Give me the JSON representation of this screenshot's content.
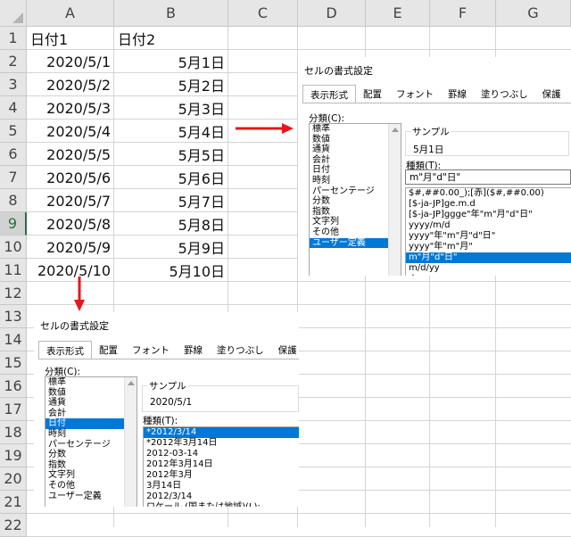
{
  "columns": [
    "A",
    "B",
    "C",
    "D",
    "E",
    "F",
    "G"
  ],
  "rows": [
    "1",
    "2",
    "3",
    "4",
    "5",
    "6",
    "7",
    "8",
    "9",
    "10",
    "11",
    "12",
    "13",
    "14",
    "15",
    "16",
    "17",
    "18",
    "19",
    "20",
    "21",
    "22"
  ],
  "selected_row": "9",
  "headers": {
    "a1": "日付1",
    "b1": "日付2"
  },
  "dates_a": [
    "2020/5/1",
    "2020/5/2",
    "2020/5/3",
    "2020/5/4",
    "2020/5/5",
    "2020/5/6",
    "2020/5/7",
    "2020/5/8",
    "2020/5/9",
    "2020/5/10"
  ],
  "dates_b": [
    "5月1日",
    "5月2日",
    "5月3日",
    "5月4日",
    "5月5日",
    "5月6日",
    "5月7日",
    "5月8日",
    "5月9日",
    "5月10日"
  ],
  "dialog_right": {
    "title": "セルの書式設定",
    "tabs": [
      "表示形式",
      "配置",
      "フォント",
      "罫線",
      "塗りつぶし",
      "保護"
    ],
    "category_label": "分類(C):",
    "categories": [
      "標準",
      "数値",
      "通貨",
      "会計",
      "日付",
      "時刻",
      "パーセンテージ",
      "分数",
      "指数",
      "文字列",
      "その他",
      "ユーザー定義"
    ],
    "selected_category": "ユーザー定義",
    "sample_label": "サンプル",
    "sample_value": "5月1日",
    "type_label": "種類(T):",
    "type_value": "m\"月\"d\"日\"",
    "types": [
      "$#,##0.00_);[赤]($#,##0.00)",
      "[$-ja-JP]ge.m.d",
      "[$-ja-JP]ggge\"年\"m\"月\"d\"日\"",
      "yyyy/m/d",
      "yyyy\"年\"m\"月\"d\"日\"",
      "yyyy\"年\"m\"月\"",
      "m\"月\"d\"日\"",
      "m/d/yy",
      "d-mmm-yy"
    ],
    "selected_type": "m\"月\"d\"日\""
  },
  "dialog_bottom": {
    "title": "セルの書式設定",
    "tabs": [
      "表示形式",
      "配置",
      "フォント",
      "罫線",
      "塗りつぶし",
      "保護"
    ],
    "category_label": "分類(C):",
    "categories": [
      "標準",
      "数値",
      "通貨",
      "会計",
      "日付",
      "時刻",
      "パーセンテージ",
      "分数",
      "指数",
      "文字列",
      "その他",
      "ユーザー定義"
    ],
    "selected_category": "日付",
    "sample_label": "サンプル",
    "sample_value": "2020/5/1",
    "type_label": "種類(T):",
    "types": [
      "*2012/3/14",
      "*2012年3月14日",
      "2012-03-14",
      "2012年3月14日",
      "2012年3月",
      "3月14日",
      "2012/3/14",
      "ロケール (国または地域)(L):"
    ],
    "selected_type": "*2012/3/14"
  },
  "colors": {
    "arrow": "#e8161c",
    "selection": "#0078d7",
    "grid": "#d4d4d4",
    "header_bg": "#e6e6e6",
    "excel_green": "#217346"
  }
}
